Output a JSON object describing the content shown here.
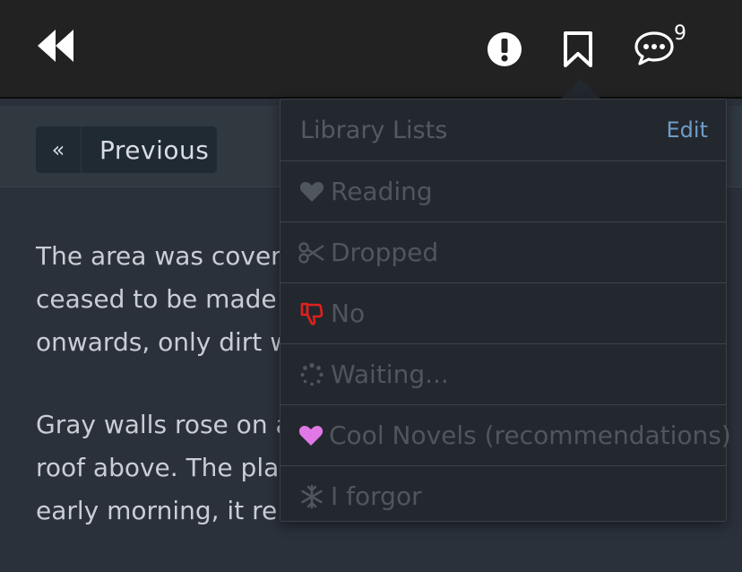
{
  "topbar": {
    "comments_count": "9"
  },
  "nav": {
    "previous_arrow": "«",
    "previous_label": "Previous"
  },
  "content": {
    "paragraphs": [
      [
        "The area was covere",
        "ceased to be made",
        "onwards, only dirt w"
      ],
      [
        "Gray walls rose on a",
        "roof above. The pla",
        "early morning, it re"
      ]
    ]
  },
  "library": {
    "title": "Library Lists",
    "edit_label": "Edit",
    "items": [
      {
        "label": "Reading",
        "icon": "heart-icon",
        "color": "#4f565d"
      },
      {
        "label": "Dropped",
        "icon": "scissors-icon",
        "color": "#4f565d"
      },
      {
        "label": "No",
        "icon": "thumbs-down-icon",
        "color": "#e0201e"
      },
      {
        "label": "Waiting...",
        "icon": "spinner-icon",
        "color": "#4f565d"
      },
      {
        "label": "Cool Novels (recommendations)",
        "icon": "heart-icon",
        "color": "#e178e6"
      },
      {
        "label": "I forgor",
        "icon": "snowflake-icon",
        "color": "#4f565d"
      }
    ]
  },
  "colors": {
    "topbar_bg": "#222222",
    "page_bg": "#2a313a",
    "edit_link": "#6f9cc8"
  }
}
